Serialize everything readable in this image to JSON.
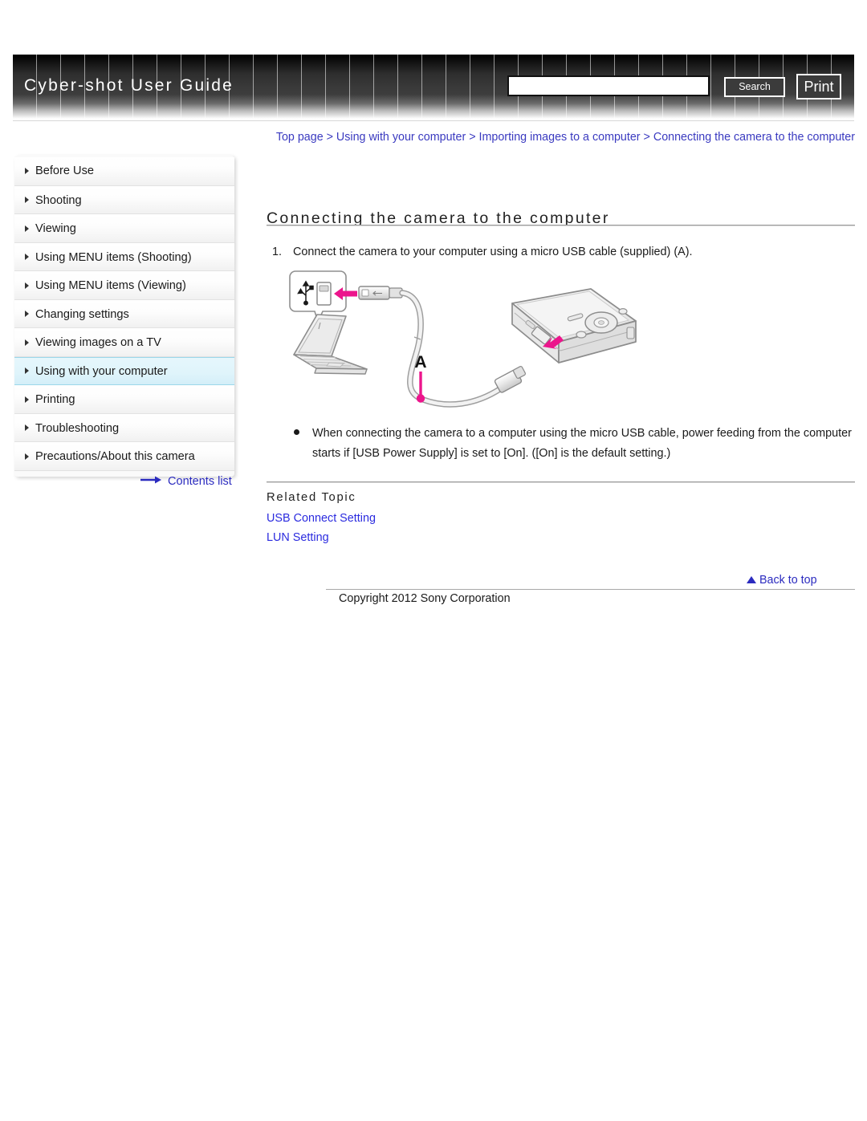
{
  "header": {
    "site_title": "Cyber-shot User Guide",
    "search": {
      "value": "",
      "placeholder": ""
    },
    "search_button_label": "Search",
    "print_button_label": "Print"
  },
  "sidebar": {
    "items": [
      {
        "label": "Before Use",
        "active": false
      },
      {
        "label": "Shooting",
        "active": false
      },
      {
        "label": "Viewing",
        "active": false
      },
      {
        "label": "Using MENU items (Shooting)",
        "active": false
      },
      {
        "label": "Using MENU items (Viewing)",
        "active": false
      },
      {
        "label": "Changing settings",
        "active": false
      },
      {
        "label": "Viewing images on a TV",
        "active": false
      },
      {
        "label": "Using with your computer",
        "active": true
      },
      {
        "label": "Printing",
        "active": false
      },
      {
        "label": "Troubleshooting",
        "active": false
      },
      {
        "label": "Precautions/About this camera",
        "active": false
      }
    ],
    "contents_list_label": "Contents list"
  },
  "main": {
    "breadcrumb": "Top page > Using with your computer > Importing images to a computer > Connecting the camera to the computer",
    "page_title": "Connecting the camera to the computer",
    "step_number": "1.",
    "step_text": "Connect the camera to your computer using a micro USB cable (supplied) (A).",
    "figure": {
      "callout_label": "A",
      "usb_symbol": "USB trident",
      "devices": [
        "laptop-computer",
        "digital-camera",
        "micro-usb-cable"
      ],
      "arrow_color": "#EC158C"
    },
    "note_text": "When connecting the camera to a computer using the micro USB cable, power feeding from the computer starts if [USB Power Supply] is set to [On]. ([On] is the default setting.)",
    "related_topic_heading": "Related Topic",
    "related_links": [
      "USB Connect Setting",
      "LUN Setting"
    ],
    "back_to_top_label": "Back to top",
    "copyright": "Copyright 2012 Sony Corporation"
  }
}
